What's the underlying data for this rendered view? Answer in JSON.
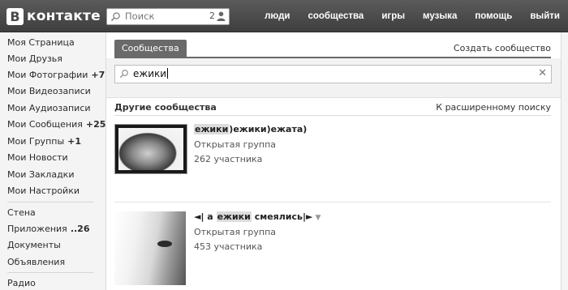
{
  "header": {
    "logo_letter": "В",
    "logo_text": "контакте",
    "search": {
      "placeholder": "Поиск",
      "count": "2"
    },
    "nav": [
      "люди",
      "сообщества",
      "игры",
      "музыка",
      "помощь",
      "выйти"
    ]
  },
  "sidebar": {
    "items": [
      {
        "label": "Моя Страница",
        "count": ""
      },
      {
        "label": "Мои Друзья",
        "count": ""
      },
      {
        "label": "Мои Фотографии",
        "count": "+7"
      },
      {
        "label": "Мои Видеозаписи",
        "count": ""
      },
      {
        "label": "Мои Аудиозаписи",
        "count": ""
      },
      {
        "label": "Мои Сообщения",
        "count": "+25"
      },
      {
        "label": "Мои Группы",
        "count": "+1"
      },
      {
        "label": "Мои Новости",
        "count": ""
      },
      {
        "label": "Мои Закладки",
        "count": ""
      },
      {
        "label": "Мои Настройки",
        "count": ""
      },
      {
        "label": "Стена",
        "count": ""
      },
      {
        "label": "Приложения",
        "count": "..26"
      },
      {
        "label": "Документы",
        "count": ""
      },
      {
        "label": "Объявления",
        "count": ""
      },
      {
        "label": "Радио",
        "count": ""
      }
    ]
  },
  "main": {
    "tab": "Сообщества",
    "create_link": "Создать сообщество",
    "search_value": "ежики",
    "section_title": "Другие сообщества",
    "advanced_link": "К расширенному поиску",
    "results": [
      {
        "title_highlight": "ежики",
        "title_rest": ")ежики)ежата)",
        "title_prefix": "",
        "type": "Открытая группа",
        "members": "262 участника"
      },
      {
        "title_prefix": "◄| а ",
        "title_highlight": "ежики",
        "title_rest": " смеялись|►",
        "type": "Открытая группа",
        "members": "453 участника"
      }
    ]
  }
}
